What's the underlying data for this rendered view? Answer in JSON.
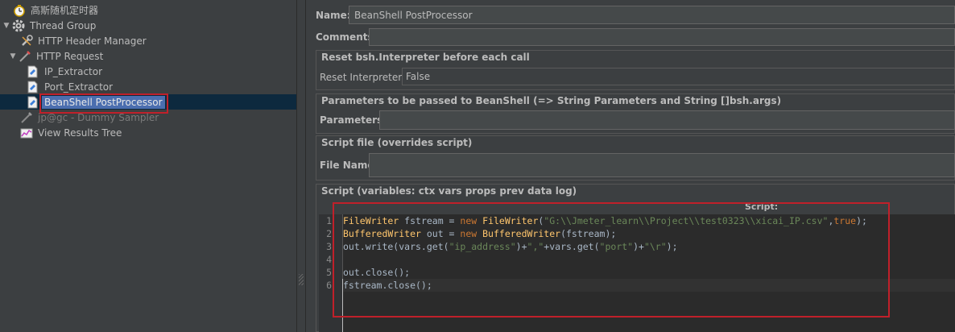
{
  "tree": {
    "items": [
      {
        "label": "高斯随机定时器",
        "icon": "timer-icon"
      },
      {
        "label": "Thread Group",
        "icon": "gear-icon"
      },
      {
        "label": "HTTP Header Manager",
        "icon": "wrench-icon"
      },
      {
        "label": "HTTP Request",
        "icon": "pipette-icon"
      },
      {
        "label": "IP_Extractor",
        "icon": "extractor-icon"
      },
      {
        "label": "Port_Extractor",
        "icon": "extractor-icon"
      },
      {
        "label": "BeanShell PostProcessor",
        "icon": "beanshell-icon"
      },
      {
        "label": "jp@gc - Dummy Sampler",
        "icon": "pipette-icon"
      },
      {
        "label": "View Results Tree",
        "icon": "chart-icon"
      }
    ]
  },
  "form": {
    "name_label": "Name:",
    "name_value": "BeanShell PostProcessor",
    "comments_label": "Comments:",
    "reset_group_title": "Reset bsh.Interpreter before each call",
    "reset_label": "Reset Interpreter:",
    "reset_value": "False",
    "params_group_title": "Parameters to be passed to BeanShell (=> String Parameters and String []bsh.args)",
    "params_label": "Parameters:",
    "file_group_title": "Script file (overrides script)",
    "file_label": "File Name:",
    "script_group_title": "Script (variables: ctx vars props prev data log)",
    "script_label": "Script:"
  },
  "editor": {
    "line_numbers": [
      "1",
      "2",
      "3",
      "4",
      "5",
      "6"
    ],
    "lines": [
      "FileWriter fstream = new FileWriter(\"G:\\\\Jmeter_learn\\\\Project\\\\test0323\\\\xicai_IP.csv\",true);",
      "BufferedWriter out = new BufferedWriter(fstream);",
      "out.write(vars.get(\"ip_address\")+\",\"+vars.get(\"port\")+\"\\r\");",
      "",
      "out.close();",
      "fstream.close();"
    ]
  },
  "colors": {
    "background": "#3c3f41",
    "selection": "#4b6eaf",
    "keyword": "#cc7832",
    "type": "#ffc66d",
    "string": "#6a8759",
    "highlight_box": "#c0202a"
  }
}
